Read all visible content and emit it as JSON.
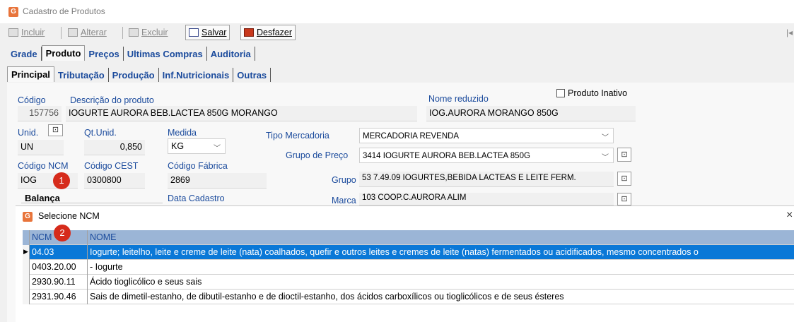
{
  "window": {
    "title": "Cadastro de Produtos",
    "icon_letter": "G"
  },
  "toolbar": {
    "incluir": "Incluir",
    "alterar": "Alterar",
    "excluir": "Excluir",
    "salvar": "Salvar",
    "desfazer": "Desfazer"
  },
  "main_tabs": [
    "Grade",
    "Produto",
    "Preços",
    "Ultimas Compras",
    "Auditoria"
  ],
  "sub_tabs": [
    "Principal",
    "Tributação",
    "Produção",
    "Inf.Nutricionais",
    "Outras"
  ],
  "form": {
    "codigo_label": "Código",
    "codigo_value": "157756",
    "descricao_label": "Descrição do produto",
    "descricao_value": "IOGURTE AURORA BEB.LACTEA 850G MORANGO",
    "nome_reduzido_label": "Nome reduzido",
    "nome_reduzido_value": "IOG.AURORA MORANGO 850G",
    "produto_inativo_label": "Produto Inativo",
    "unid_label": "Unid.",
    "unid_value": "UN",
    "qt_unid_label": "Qt.Unid.",
    "qt_unid_value": "0,850",
    "medida_label": "Medida",
    "medida_value": "KG",
    "tipo_mercadoria_label": "Tipo Mercadoria",
    "tipo_mercadoria_value": "MERCADORIA REVENDA",
    "grupo_preco_label": "Grupo de Preço",
    "grupo_preco_value": "3414 IOGURTE AURORA BEB.LACTEA 850G",
    "codigo_ncm_label": "Código NCM",
    "codigo_ncm_value": "IOG",
    "codigo_cest_label": "Código CEST",
    "codigo_cest_value": "0300800",
    "codigo_fabrica_label": "Código Fábrica",
    "codigo_fabrica_value": "2869",
    "grupo_label": "Grupo",
    "grupo_value": "53 7.49.09 IOGURTES,BEBIDA LACTEAS E LEITE FERM.",
    "balanca_label": "Balança",
    "data_cadastro_label": "Data Cadastro",
    "marca_label": "Marca",
    "marca_value": "103 COOP.C.AURORA ALIM"
  },
  "badges": {
    "one": "1",
    "two": "2"
  },
  "dialog": {
    "title": "Selecione NCM",
    "close": "×",
    "columns": [
      "NCM",
      "NOME"
    ],
    "rows": [
      {
        "ncm": "04.03",
        "nome": "Iogurte; leitelho, leite e creme de leite (nata) coalhados, quefir e outros leites e cremes de leite (natas) fermentados ou acidificados, mesmo concentrados o"
      },
      {
        "ncm": "0403.20.00",
        "nome": "- Iogurte"
      },
      {
        "ncm": "2930.90.11",
        "nome": "Ácido tioglicólico e seus sais"
      },
      {
        "ncm": "2931.90.46",
        "nome": "Sais de dimetil-estanho, de dibutil-estanho e de dioctil-estanho, dos ácidos carboxílicos ou tioglicólicos e de seus ésteres"
      }
    ]
  }
}
